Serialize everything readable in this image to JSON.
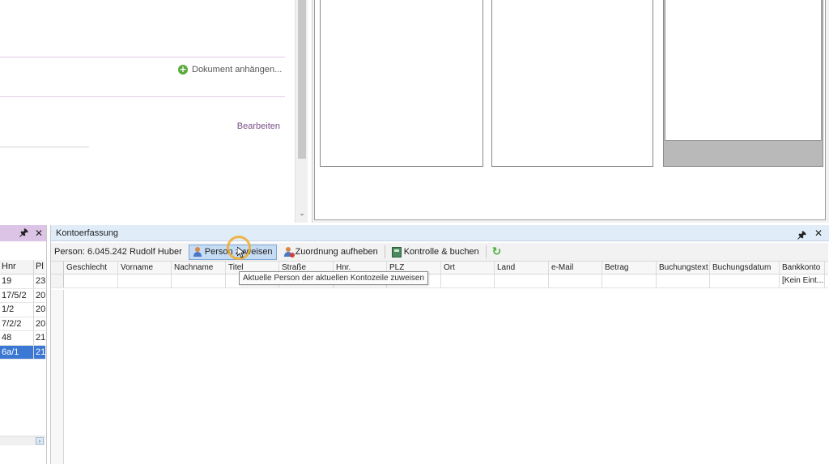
{
  "upper_form": {
    "attach_label": "Dokument anhängen...",
    "edit_label": "Bearbeiten"
  },
  "left_panel": {
    "columns": [
      "Hnr",
      "Pl"
    ],
    "rows": [
      {
        "hnr": "19",
        "pl": "23",
        "selected": false
      },
      {
        "hnr": "17/5/2",
        "pl": "20",
        "selected": false
      },
      {
        "hnr": "1/2",
        "pl": "20",
        "selected": false
      },
      {
        "hnr": "7/2/2",
        "pl": "20",
        "selected": false
      },
      {
        "hnr": "48",
        "pl": "21",
        "selected": false
      },
      {
        "hnr": "6a/1",
        "pl": "21",
        "selected": true
      }
    ]
  },
  "main_panel": {
    "title": "Kontoerfassung",
    "person_label": "Person:  6.045.242 Rudolf Huber",
    "toolbar": {
      "assign_label": "Person zuweisen",
      "unassign_label": "Zuordnung aufheben",
      "check_label": "Kontrolle & buchen"
    },
    "grid": {
      "columns": [
        "Geschlecht",
        "Vorname",
        "Nachname",
        "Titel",
        "Straße",
        "Hnr.",
        "PLZ",
        "Ort",
        "Land",
        "e-Mail",
        "Betrag",
        "Buchungstext",
        "Buchungsdatum",
        "Bankkonto"
      ],
      "rows": [
        [
          "",
          "",
          "",
          "",
          "",
          "",
          "",
          "",
          "",
          "",
          "",
          "",
          "",
          "[Kein Eint..."
        ]
      ]
    },
    "tooltip": "Aktuelle Person der aktuellen Kontozeile zuweisen"
  }
}
